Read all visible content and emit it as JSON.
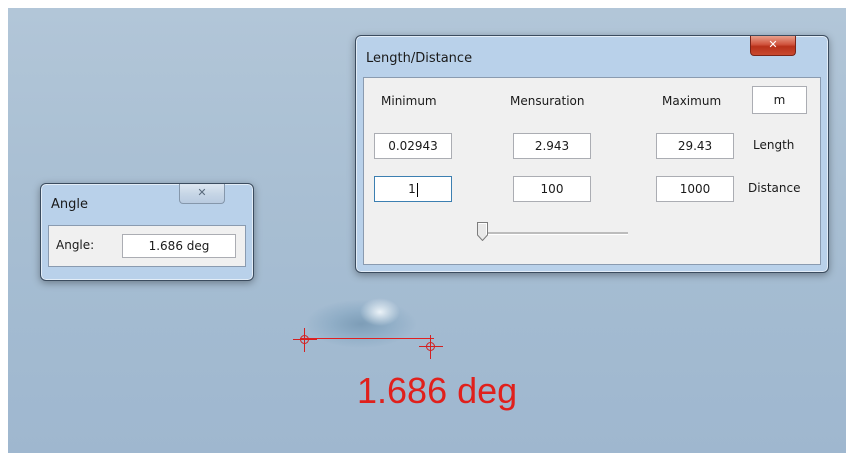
{
  "angle_window": {
    "title": "Angle",
    "close_glyph": "✕",
    "angle_label": "Angle:",
    "angle_value": "1.686 deg"
  },
  "length_window": {
    "title": "Length/Distance",
    "close_glyph": "✕",
    "headers": {
      "minimum": "Minimum",
      "mensuration": "Mensuration",
      "maximum": "Maximum"
    },
    "unit": "m",
    "length_row": {
      "label": "Length",
      "minimum": "0.02943",
      "mensuration": "2.943",
      "maximum": "29.43"
    },
    "distance_row": {
      "label": "Distance",
      "minimum": "1",
      "mensuration": "100",
      "maximum": "1000"
    },
    "slider": {
      "value_fraction": 0.0
    }
  },
  "measurement": {
    "overlay_label": "1.686 deg",
    "line_color": "#e0201c"
  }
}
